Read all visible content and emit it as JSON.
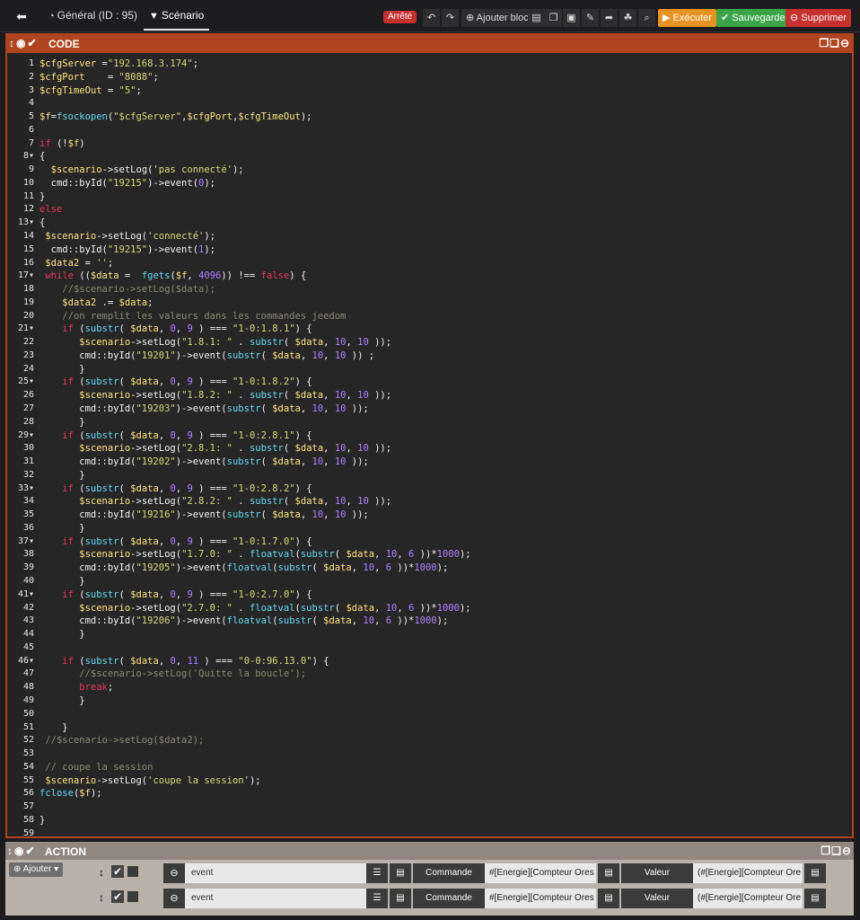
{
  "topbar": {
    "back_icon": "circle-arrow-left-icon",
    "tabs": [
      {
        "icon": "tachometer-icon",
        "label": "Général (ID : 95)"
      },
      {
        "icon": "filter-icon",
        "label": "Scénario"
      }
    ],
    "status_badge": "Arrêté",
    "add_block_label": "Ajouter bloc",
    "execute_label": "Exécuter",
    "save_label": "Sauvegarder",
    "delete_label": "Supprimer",
    "colors": {
      "badge": "#c6302f",
      "execute": "#e89221",
      "save": "#3aa548",
      "delete": "#c6302f"
    }
  },
  "code_block": {
    "title": "CODE",
    "color": "#b0441e",
    "lines": [
      "$cfgServer =\"192.168.3.174\";",
      "$cfgPort    = \"8088\";",
      "$cfgTimeOut = \"5\";",
      "",
      "$f=fsockopen(\"$cfgServer\",$cfgPort,$cfgTimeOut);",
      "",
      "if (!$f)",
      "{",
      "  $scenario->setLog('pas connecté');",
      "  cmd::byId(\"19215\")->event(0);",
      "}",
      "else",
      "{",
      " $scenario->setLog('connecté');",
      "  cmd::byId(\"19215\")->event(1);",
      " $data2 = '';",
      " while (($data =  fgets($f, 4096)) !== false) {",
      "    //$scenario->setLog($data);",
      "    $data2 .= $data;",
      "    //on remplit les valeurs dans les commandes jeedom",
      "    if (substr( $data, 0, 9 ) === \"1-0:1.8.1\") {",
      "       $scenario->setLog(\"1.8.1: \" . substr( $data, 10, 10 ));",
      "       cmd::byId(\"19201\")->event(substr( $data, 10, 10 )) ;",
      "       }",
      "    if (substr( $data, 0, 9 ) === \"1-0:1.8.2\") {",
      "       $scenario->setLog(\"1.8.2: \" . substr( $data, 10, 10 ));",
      "       cmd::byId(\"19203\")->event(substr( $data, 10, 10 ));",
      "       }",
      "    if (substr( $data, 0, 9 ) === \"1-0:2.8.1\") {",
      "       $scenario->setLog(\"2.8.1: \" . substr( $data, 10, 10 ));",
      "       cmd::byId(\"19202\")->event(substr( $data, 10, 10 ));",
      "       }",
      "    if (substr( $data, 0, 9 ) === \"1-0:2.8.2\") {",
      "       $scenario->setLog(\"2.8.2: \" . substr( $data, 10, 10 ));",
      "       cmd::byId(\"19216\")->event(substr( $data, 10, 10 ));",
      "       }",
      "    if (substr( $data, 0, 9 ) === \"1-0:1.7.0\") {",
      "       $scenario->setLog(\"1.7.0: \" . floatval(substr( $data, 10, 6 ))*1000);",
      "       cmd::byId(\"19205\")->event(floatval(substr( $data, 10, 6 ))*1000);",
      "       }",
      "    if (substr( $data, 0, 9 ) === \"1-0:2.7.0\") {",
      "       $scenario->setLog(\"2.7.0: \" . floatval(substr( $data, 10, 6 ))*1000);",
      "       cmd::byId(\"19206\")->event(floatval(substr( $data, 10, 6 ))*1000);",
      "       }",
      "",
      "    if (substr( $data, 0, 11 ) === \"0-0:96.13.0\") {",
      "       //$scenario->setLog('Quitte la boucle');",
      "       break;",
      "       }",
      "",
      "    }",
      " //$scenario->setLog($data2);",
      "",
      " // coupe la session",
      " $scenario->setLog('coupe la session');",
      "fclose($f);",
      "",
      "}",
      ""
    ],
    "fold_lines": [
      8,
      13,
      17,
      21,
      25,
      29,
      33,
      37,
      41,
      46
    ]
  },
  "action_block": {
    "title": "ACTION",
    "add_label": "Ajouter",
    "rows": [
      {
        "event": "event",
        "cmd_label": "Commande",
        "cmd_value": "#[Energie][Compteur Ores",
        "val_label": "Valeur",
        "val_value": "(#[Energie][Compteur Ore"
      },
      {
        "event": "event",
        "cmd_label": "Commande",
        "cmd_value": "#[Energie][Compteur Ores",
        "val_label": "Valeur",
        "val_value": "(#[Energie][Compteur Ore"
      }
    ]
  }
}
